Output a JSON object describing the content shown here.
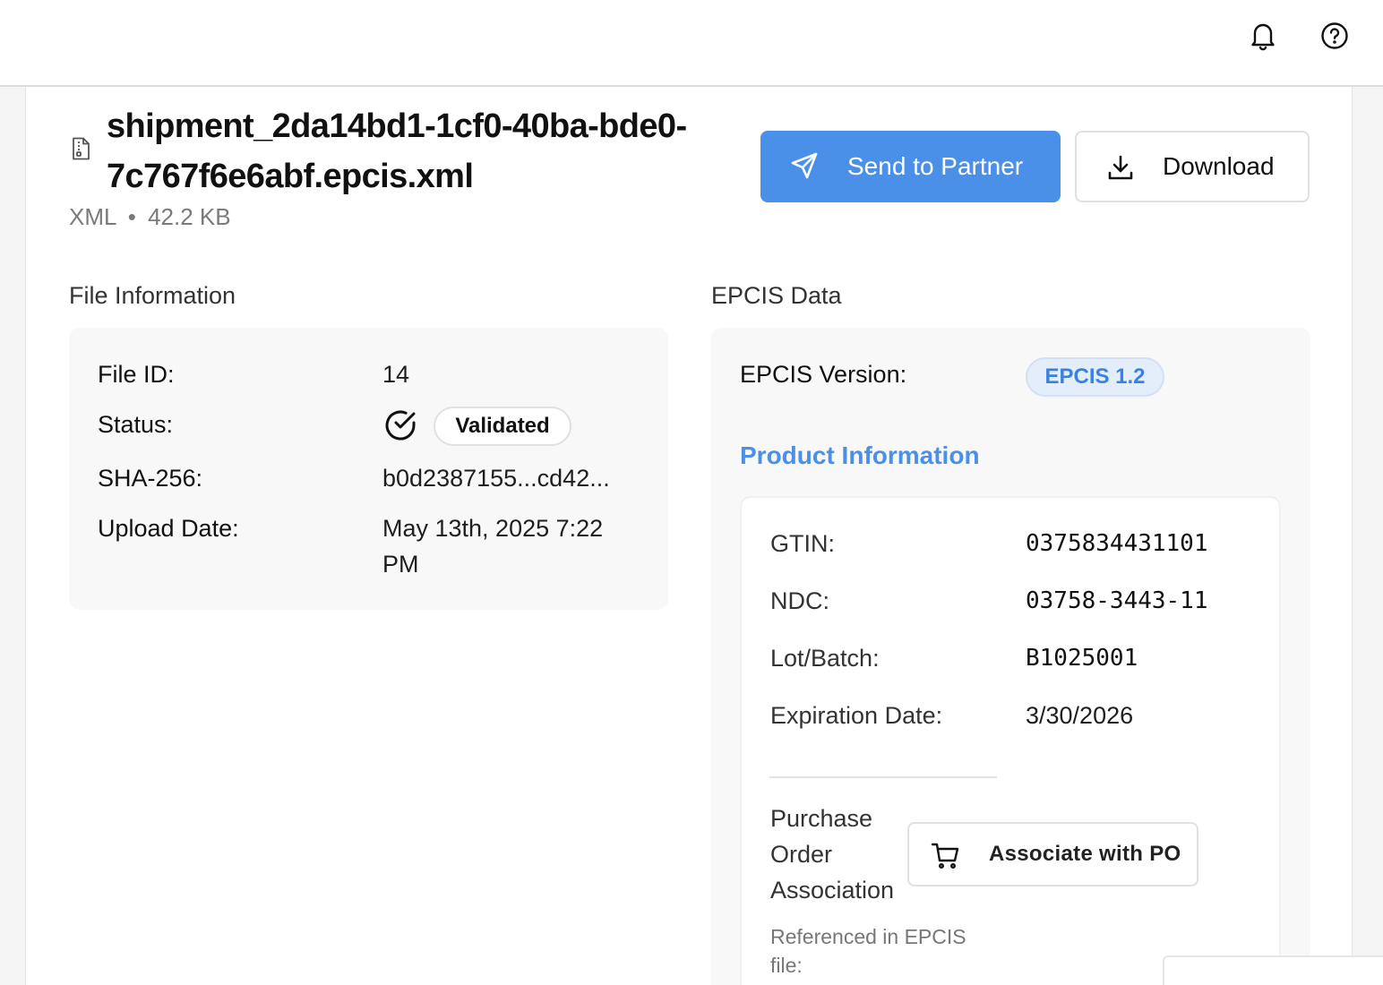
{
  "header": {
    "icons": [
      "bell-icon",
      "help-circle-icon"
    ]
  },
  "file": {
    "title": "shipment_2da14bd1-1cf0-40ba-bde0-7c767f6e6abf.epcis.xml",
    "type": "XML",
    "separator": "•",
    "size": "42.2 KB"
  },
  "actions": {
    "send_label": "Send to Partner",
    "download_label": "Download"
  },
  "file_info": {
    "heading": "File Information",
    "id_label": "File ID:",
    "id_value": "14",
    "status_label": "Status:",
    "status_value": "Validated",
    "sha_label": "SHA-256:",
    "sha_value": "b0d2387155...cd42...",
    "upload_label": "Upload Date:",
    "upload_value": "May 13th, 2025 7:22 PM"
  },
  "epcis": {
    "heading": "EPCIS Data",
    "version_label": "EPCIS Version:",
    "version_value": "EPCIS 1.2",
    "product_heading": "Product Information",
    "gtin_label": "GTIN:",
    "gtin_value": "0375834431101",
    "ndc_label": "NDC:",
    "ndc_value": "03758-3443-11",
    "lot_label": "Lot/Batch:",
    "lot_value": "B1025001",
    "exp_label": "Expiration Date:",
    "exp_value": "3/30/2026",
    "po_label": "Purchase Order Association",
    "po_button": "Associate with PO",
    "ref_note": "Referenced in EPCIS file:"
  },
  "colors": {
    "accent": "#4a90e8",
    "badge_bg": "#e4eefb",
    "card_bg": "#f8f8f8"
  }
}
